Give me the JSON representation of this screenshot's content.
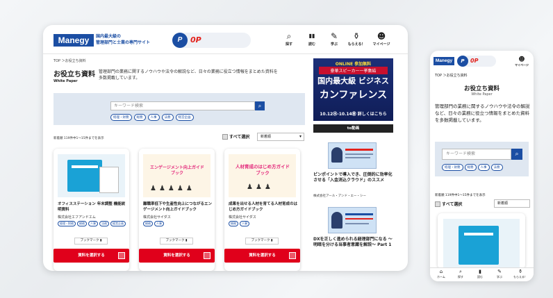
{
  "desktop": {
    "logo_text": "Manegy",
    "tagline_1": "国内最大級の",
    "tagline_2": "管理部門と士業の専門サイト",
    "points_icon": "P",
    "points_value": "0P",
    "nav": [
      {
        "icon": "search-icon",
        "glyph": "⌕",
        "label": "探す"
      },
      {
        "icon": "book-icon",
        "glyph": "▮▮",
        "label": "読む"
      },
      {
        "icon": "pen-icon",
        "glyph": "✎",
        "label": "学ぶ"
      },
      {
        "icon": "gift-icon",
        "glyph": "⚱",
        "label": "もらえる！"
      },
      {
        "icon": "user-icon",
        "glyph": "☻",
        "label": "マイページ"
      }
    ],
    "breadcrumb": "TOP ＞お役立ち資料",
    "page_title": "お役立ち資料",
    "page_subtitle": "White Paper",
    "page_description": "管理部門の業務に関するノウハウや法令の解説など、日々の業務に役立つ情報をまとめた資料を多数掲載しています。",
    "search_placeholder": "キーワード検索",
    "search_tags": [
      "経理・財務",
      "総務",
      "人事",
      "法務",
      "経営企画"
    ],
    "result_count": "新着順 119件中1〜15件までを表示",
    "select_all_label": "すべて選択",
    "sort_value": "新着順",
    "cards": [
      {
        "title": "オフィスステーション 年末調整 機能説明資料",
        "company": "株式会社エフアンドエム",
        "tags": [
          "経理・財務",
          "総務",
          "人事",
          "法務",
          "経営企画"
        ],
        "bookmark": "ブックマーク",
        "cta": "資料を選択する",
        "image_text": ""
      },
      {
        "title": "離職率低下や生産性向上につながるエンゲージメント向上ガイドブック",
        "company": "株式会社サイダス",
        "tags": [
          "総務",
          "人事"
        ],
        "bookmark": "ブックマーク",
        "cta": "資料を選択する",
        "image_text": "エンゲージメント向上ガイドブック"
      },
      {
        "title": "成果を出せる人材を育てる人材育成のはじめ方ガイドブック",
        "company": "株式会社サイダス",
        "tags": [
          "総務",
          "人事"
        ],
        "bookmark": "ブックマーク",
        "cta": "資料を選択する",
        "image_text": "人材育成のはじめ方ガイドブック"
      }
    ],
    "sidebar": {
      "ad_line1": "ONLINE 参加無料",
      "ad_line2": "豪華スピーカー一挙集結",
      "ad_line3": "国内最大級 ビジネス",
      "ad_line4": "カンファレンス",
      "ad_line5": "10.12㊌-10.14㊎ 詳しくはこちら",
      "to_video": "to動画",
      "articles": [
        {
          "title": "ピンポイントで導入でき、圧倒的に効率化させる「入金消込クラウド」のススメ",
          "company": "株式会社アール・アンド・エー・シー"
        },
        {
          "title": "DXを正しく進められる経理部門になる 〜明暗を分ける当事者意識を解説〜 Part 1",
          "company": ""
        }
      ]
    }
  },
  "mobile": {
    "logo_text": "Manegy",
    "points_icon": "P",
    "points_value": "0P",
    "mypage_label": "マイページ",
    "breadcrumb": "TOP ＞お役立ち資料",
    "page_title": "お役立ち資料",
    "page_subtitle": "White Paper",
    "page_description": "管理部門の業務に関するノウハウや法令の解説など、日々の業務に役立つ情報をまとめた資料を多数掲載しています。",
    "search_placeholder": "キーワード検索",
    "search_tags": [
      "経理・財務",
      "総務",
      "人事",
      "法務"
    ],
    "result_count": "新着順 119件中1〜15件までを表示",
    "select_all_label": "すべて選択",
    "sort_value": "新着順",
    "tabs": [
      {
        "icon": "home-icon",
        "glyph": "⌂",
        "label": "ホーム"
      },
      {
        "icon": "search-icon",
        "glyph": "⌕",
        "label": "探す"
      },
      {
        "icon": "book-icon",
        "glyph": "▮",
        "label": "読む"
      },
      {
        "icon": "pen-icon",
        "glyph": "✎",
        "label": "学ぶ"
      },
      {
        "icon": "gift-icon",
        "glyph": "⚱",
        "label": "もらえる！"
      }
    ]
  },
  "colors": {
    "brand": "#1b4ea3",
    "cta": "#e0001b",
    "points": "#e3211b"
  }
}
